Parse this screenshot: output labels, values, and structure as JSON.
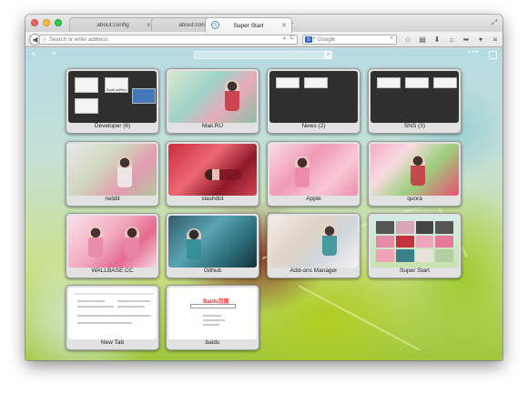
{
  "browser": {
    "tabs": [
      {
        "label": "about:config",
        "active": false
      },
      {
        "label": "about:config",
        "active": false
      },
      {
        "label": "Super Start",
        "active": true
      }
    ],
    "url_placeholder": "Search or enter address",
    "search_engine": "S",
    "search_placeholder": "Google"
  },
  "speed_dial": {
    "tiles": [
      {
        "label": "Developer (6)",
        "type": "folder"
      },
      {
        "label": "Mail.RU",
        "type": "site"
      },
      {
        "label": "News (2)",
        "type": "folder"
      },
      {
        "label": "SNS (3)",
        "type": "folder"
      },
      {
        "label": "reddit",
        "type": "site"
      },
      {
        "label": "slashdot",
        "type": "site"
      },
      {
        "label": "Apple",
        "type": "site"
      },
      {
        "label": "quora",
        "type": "site"
      },
      {
        "label": "WALLBASE.CC",
        "type": "site"
      },
      {
        "label": "Github",
        "type": "site"
      },
      {
        "label": "Add-ons Manager",
        "type": "site"
      },
      {
        "label": "Super Start",
        "type": "site"
      },
      {
        "label": "New Tab",
        "type": "site"
      },
      {
        "label": "baidu",
        "type": "site"
      }
    ],
    "developer_minis": [
      "",
      "Build softfoo",
      ""
    ],
    "baidu_logo": "Baidu百度"
  },
  "icons": {
    "search_engine_arrow": "▾",
    "url_star": "☆",
    "url_reload": "C",
    "search_mag": "🔍",
    "menu_dots": "•••"
  }
}
